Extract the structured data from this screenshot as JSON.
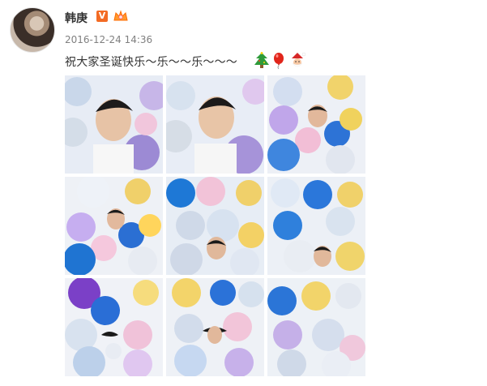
{
  "post": {
    "author": "韩庚",
    "timestamp": "2016-12-24 14:36",
    "text": "祝大家圣诞快乐～乐～～乐～～～",
    "emojis": [
      "christmas-tree",
      "balloon",
      "santa-face"
    ],
    "verified_badge_label": "V"
  },
  "photos": [
    {
      "id": "p1",
      "subject": "face-center"
    },
    {
      "id": "p2",
      "subject": "face-center-2"
    },
    {
      "id": "p3",
      "subject": "peek-center"
    },
    {
      "id": "p4",
      "subject": "peek-left"
    },
    {
      "id": "p5",
      "subject": "peek-bottom"
    },
    {
      "id": "p6",
      "subject": "peek-right"
    },
    {
      "id": "p7",
      "subject": "balloons-purple"
    },
    {
      "id": "p8",
      "subject": "balloons-yellow"
    },
    {
      "id": "p9",
      "subject": "balloons-blue"
    }
  ],
  "colors": {
    "text": "#333333",
    "meta": "#808080",
    "badge": "#f36b24"
  }
}
